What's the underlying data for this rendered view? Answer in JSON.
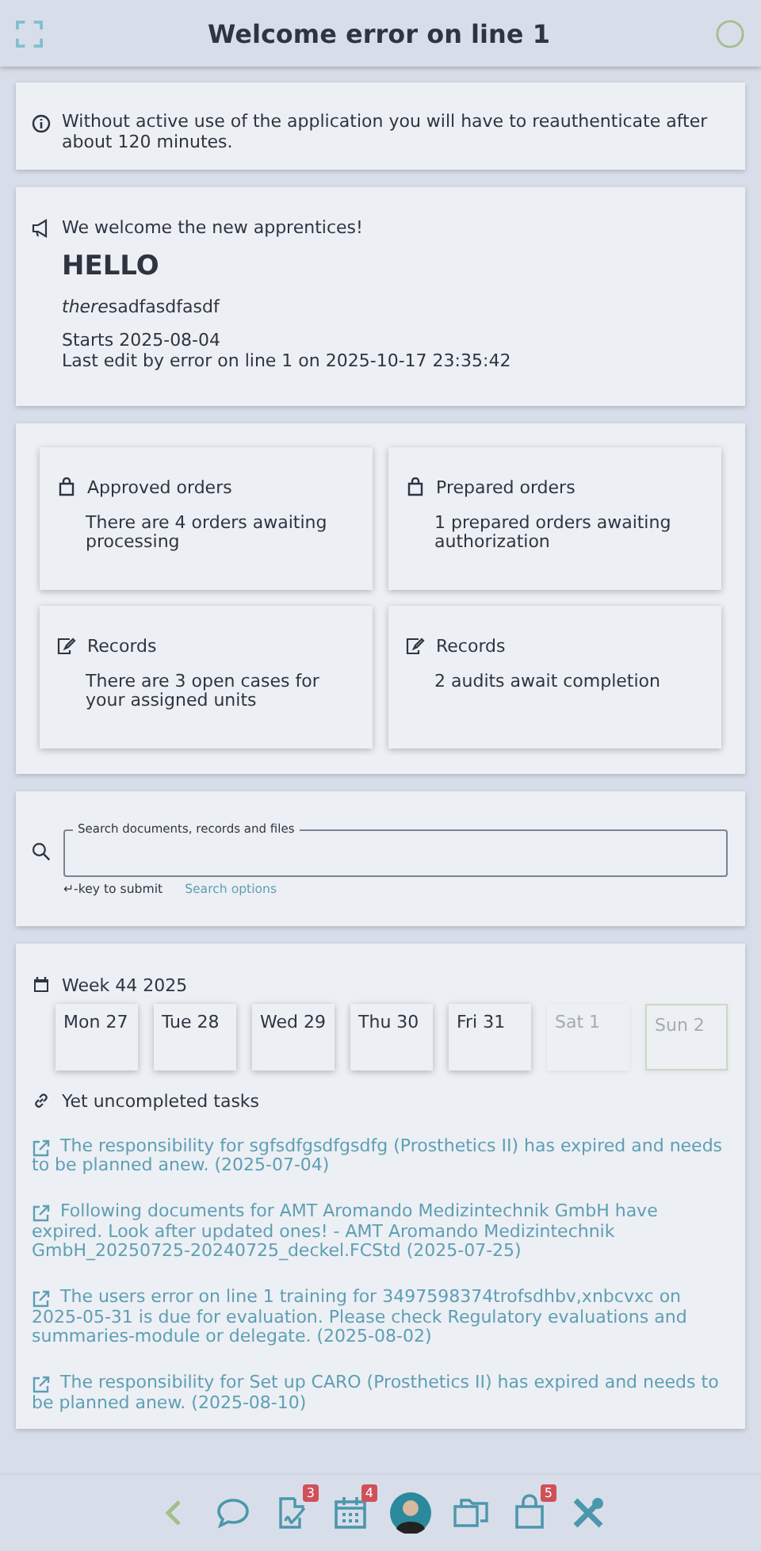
{
  "header": {
    "title": "Welcome error on line 1"
  },
  "notice": {
    "text": "Without active use of the application you will have to reauthenticate after about 120 minutes."
  },
  "announcement": {
    "title": "We welcome the new apprentices!",
    "heading": "HELLO",
    "body": [
      {
        "text": "there",
        "italic": true
      },
      {
        "text": "sadfasdfasdf",
        "italic": false
      }
    ],
    "starts": "Starts 2025-08-04",
    "last_edit": "Last edit by error on line 1 on 2025-10-17 23:35:42"
  },
  "tiles": [
    {
      "kind": "bag",
      "title": "Approved orders",
      "text": "There are 4 orders awaiting processing"
    },
    {
      "kind": "bag",
      "title": "Prepared orders",
      "text": "1 prepared orders awaiting authorization"
    },
    {
      "kind": "edit",
      "title": "Records",
      "text": "There are 3 open cases for your assigned units"
    },
    {
      "kind": "edit",
      "title": "Records",
      "text": "2 audits await completion"
    }
  ],
  "search": {
    "placeholder": "Search documents, records and files",
    "hint": "↵-key to submit",
    "options_link": "Search options"
  },
  "week": {
    "title": "Week 44 2025",
    "days": [
      {
        "label": "Mon 27",
        "disabled": false,
        "selected": false
      },
      {
        "label": "Tue 28",
        "disabled": false,
        "selected": false
      },
      {
        "label": "Wed 29",
        "disabled": false,
        "selected": false
      },
      {
        "label": "Thu 30",
        "disabled": false,
        "selected": false
      },
      {
        "label": "Fri 31",
        "disabled": false,
        "selected": false
      },
      {
        "label": "Sat 1",
        "disabled": true,
        "selected": false
      },
      {
        "label": "Sun 2",
        "disabled": true,
        "selected": true
      }
    ]
  },
  "tasks": {
    "title": "Yet uncompleted tasks",
    "items": [
      "The responsibility for sgfsdfgsdfgsdfg (Prosthetics II) has expired and needs to be planned anew. (2025-07-04)",
      "Following documents for AMT Aromando Medizintechnik GmbH have expired. Look after updated ones! - AMT Aromando Medizintechnik GmbH_20250725-20240725_deckel.FCStd (2025-07-25)",
      "The users error on line 1 training for 3497598374trofsdhbv,xnbcvxc on 2025-05-31 is due for evaluation. Please check Regulatory evaluations and summaries-module or delegate. (2025-08-02)",
      "The responsibility for Set up CARO (Prosthetics II) has expired and needs to be planned anew. (2025-08-10)"
    ]
  },
  "nav": [
    {
      "kind": "back"
    },
    {
      "kind": "chat"
    },
    {
      "kind": "document",
      "badge": "3"
    },
    {
      "kind": "calendar",
      "badge": "4"
    },
    {
      "kind": "avatar"
    },
    {
      "kind": "folder"
    },
    {
      "kind": "bag",
      "badge": "5"
    },
    {
      "kind": "tools"
    }
  ]
}
